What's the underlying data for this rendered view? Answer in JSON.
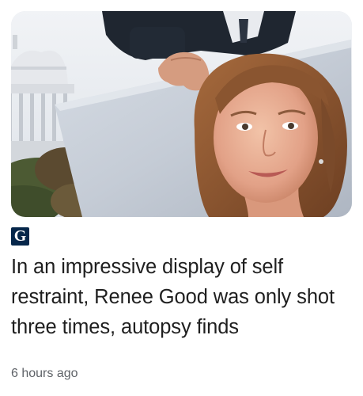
{
  "article": {
    "source_logo_text": "G",
    "headline": "In an impressive display of self restraint, Renee Good was only shot three times, autopsy finds",
    "timestamp": "6 hours ago"
  },
  "colors": {
    "source_logo_bg": "#05264a",
    "headline_text": "#1f1f1f",
    "timestamp_text": "#5f6368"
  }
}
